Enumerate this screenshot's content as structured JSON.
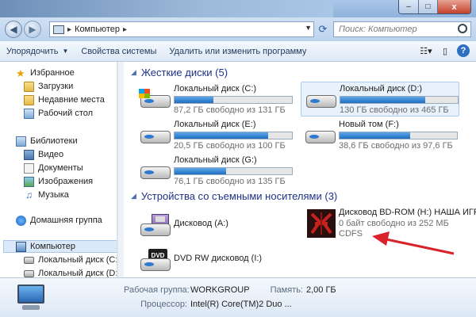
{
  "window": {
    "minimize": "–",
    "maximize": "□",
    "close": "x"
  },
  "address": {
    "path_item": "Компьютер",
    "search_placeholder": "Поиск: Компьютер"
  },
  "toolbar": {
    "organize": "Упорядочить",
    "system_properties": "Свойства системы",
    "uninstall": "Удалить или изменить программу"
  },
  "nav": {
    "favorites": "Избранное",
    "downloads": "Загрузки",
    "recent": "Недавние места",
    "desktop": "Рабочий стол",
    "libraries": "Библиотеки",
    "video": "Видео",
    "documents": "Документы",
    "images": "Изображения",
    "music": "Музыка",
    "homegroup": "Домашняя группа",
    "computer": "Компьютер",
    "disk_c": "Локальный диск (C:)",
    "disk_d": "Локальный диск (D:)"
  },
  "groups": {
    "hard_disks": "Жесткие диски (5)",
    "removable": "Устройства со съемными носителями (3)"
  },
  "drives": [
    {
      "name": "Локальный диск (C:)",
      "free": "87,2 ГБ свободно из 131 ГБ",
      "used_fraction": 0.33
    },
    {
      "name": "Локальный диск (D:)",
      "free": "130 ГБ свободно из 465 ГБ",
      "used_fraction": 0.72
    },
    {
      "name": "Локальный диск (E:)",
      "free": "20,5 ГБ свободно из 100 ГБ",
      "used_fraction": 0.8
    },
    {
      "name": "Новый том (F:)",
      "free": "38,6 ГБ свободно из 97,6 ГБ",
      "used_fraction": 0.6
    },
    {
      "name": "Локальный диск (G:)",
      "free": "76,1 ГБ свободно из 135 ГБ",
      "used_fraction": 0.44
    }
  ],
  "removable": {
    "floppy": "Дисковод (A:)",
    "dvd": "DVD RW дисковод (I:)",
    "bd_name": "Дисковод BD-ROM (H:) НАША ИГРА",
    "bd_free": "0 байт свободно из 252 МБ",
    "bd_fs": "CDFS",
    "dvd_badge": "DVD"
  },
  "details": {
    "workgroup_label": "Рабочая группа:",
    "workgroup_value": "WORKGROUP",
    "memory_label": "Память:",
    "memory_value": "2,00 ГБ",
    "cpu_label": "Процессор:",
    "cpu_value": "Intel(R) Core(TM)2 Duo ..."
  }
}
